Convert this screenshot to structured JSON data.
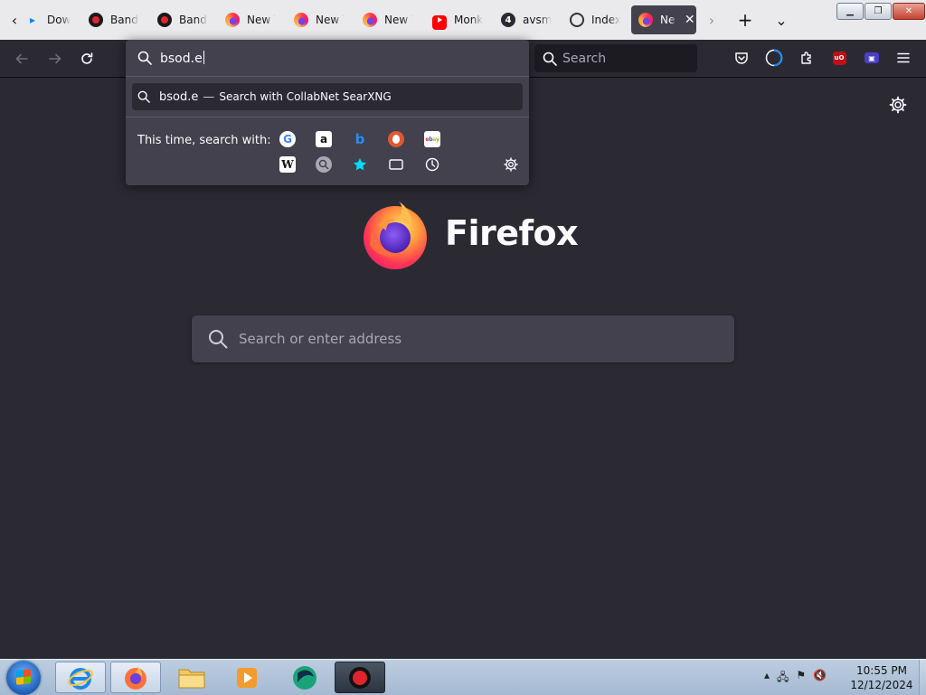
{
  "tabs": [
    {
      "title": "Down",
      "favicon": "download-icon"
    },
    {
      "title": "Bandi",
      "favicon": "bandicam-icon"
    },
    {
      "title": "Bandi",
      "favicon": "bandicam-icon"
    },
    {
      "title": "New T",
      "favicon": "firefox-icon"
    },
    {
      "title": "New T",
      "favicon": "firefox-icon"
    },
    {
      "title": "New T",
      "favicon": "firefox-icon"
    },
    {
      "title": "Monk",
      "favicon": "youtube-icon"
    },
    {
      "title": "avsme",
      "favicon": "number-four-icon"
    },
    {
      "title": "Index",
      "favicon": "github-icon"
    },
    {
      "title": "Ne",
      "favicon": "firefox-icon",
      "active": true
    }
  ],
  "tabstrip": {
    "scroll_left": "‹",
    "scroll_right": "›",
    "new_tab": "+",
    "list_all": "⌄",
    "close_tab": "✕"
  },
  "window_controls": {
    "minimize": "▁",
    "maximize": "❐",
    "close": "✕"
  },
  "navbar": {
    "search_placeholder": "Search"
  },
  "urlbar": {
    "value": "bsod.e",
    "suggestion": {
      "text": "bsod.e",
      "dash": "—",
      "action": "Search with CollabNet SearXNG"
    },
    "one_offs_label": "This time, search with:",
    "engines": [
      "google",
      "amazon",
      "bing",
      "duckduckgo",
      "ebay",
      "wikipedia",
      "searxng",
      "bookmarks",
      "tabs",
      "history"
    ]
  },
  "newtab": {
    "brand": "Firefox",
    "search_placeholder": "Search or enter address"
  },
  "taskbar": {
    "apps": [
      "internet-explorer",
      "firefox",
      "file-explorer",
      "media-player",
      "browser-app",
      "bandicam"
    ],
    "clock_time": "10:55 PM",
    "clock_date": "12/12/2024"
  },
  "colors": {
    "toolbar": "#2b2a33",
    "popup": "#42414d",
    "tabstrip": "#eaeaed",
    "accent": "#0a84ff"
  }
}
